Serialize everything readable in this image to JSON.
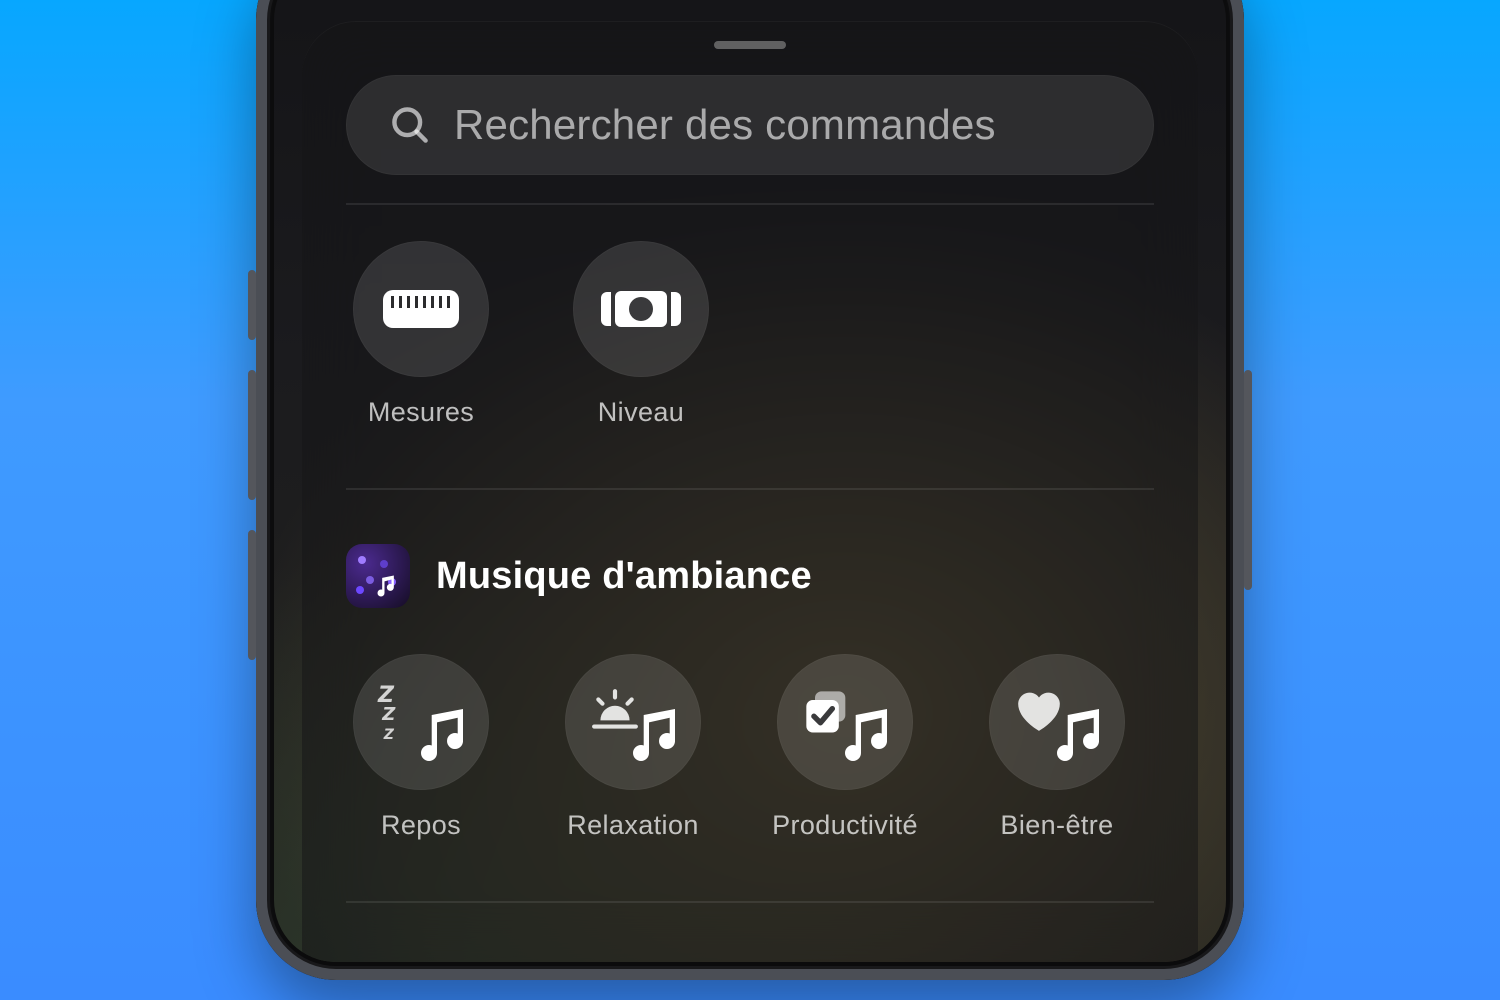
{
  "search": {
    "placeholder": "Rechercher des commandes"
  },
  "section1": {
    "tiles": [
      {
        "label": "Mesures"
      },
      {
        "label": "Niveau"
      }
    ]
  },
  "ambient": {
    "title": "Musique d'ambiance",
    "tiles": [
      {
        "label": "Repos"
      },
      {
        "label": "Relaxation"
      },
      {
        "label": "Productivité"
      },
      {
        "label": "Bien-être"
      }
    ]
  }
}
